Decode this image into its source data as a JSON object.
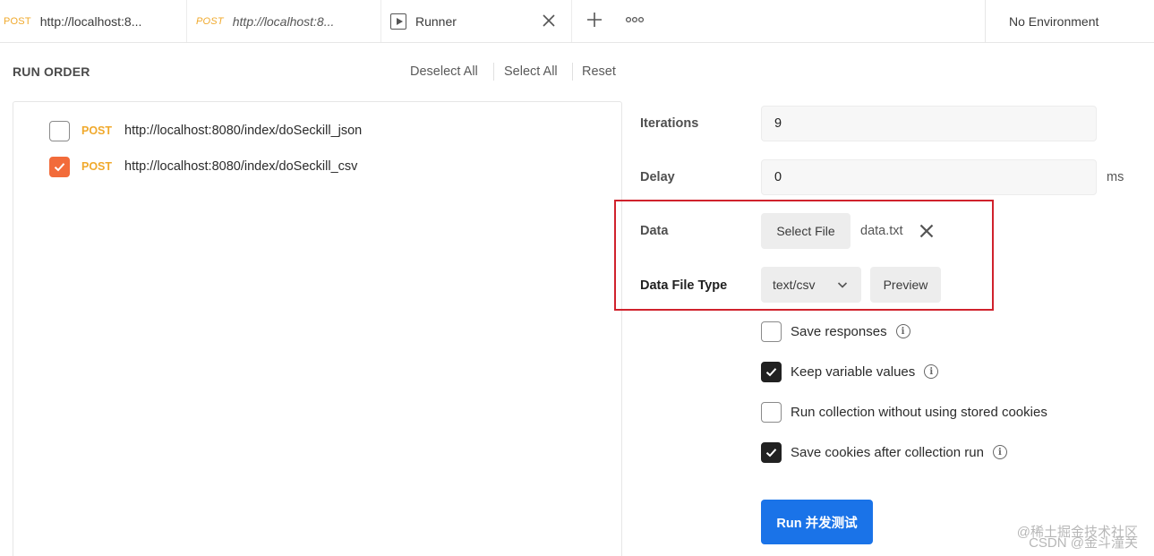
{
  "tabs": [
    {
      "method": "POST",
      "url": "http://localhost:8..."
    },
    {
      "method": "POST",
      "url": "http://localhost:8..."
    },
    {
      "label": "Runner"
    }
  ],
  "environment": "No Environment",
  "run_order": {
    "title": "RUN ORDER",
    "deselect_all": "Deselect All",
    "select_all": "Select All",
    "reset": "Reset",
    "requests": [
      {
        "method": "POST",
        "url": "http://localhost:8080/index/doSeckill_json",
        "checked": false
      },
      {
        "method": "POST",
        "url": "http://localhost:8080/index/doSeckill_csv",
        "checked": true
      }
    ]
  },
  "settings": {
    "iterations_label": "Iterations",
    "iterations_value": "9",
    "delay_label": "Delay",
    "delay_value": "0",
    "delay_unit": "ms",
    "data_label": "Data",
    "select_file_label": "Select File",
    "file_name": "data.txt",
    "data_file_type_label": "Data File Type",
    "data_file_type_value": "text/csv",
    "preview_label": "Preview",
    "options": [
      {
        "label": "Save responses",
        "checked": false
      },
      {
        "label": "Keep variable values",
        "checked": true
      },
      {
        "label": "Run collection without using stored cookies",
        "checked": false
      },
      {
        "label": "Save cookies after collection run",
        "checked": true
      }
    ],
    "run_button": "Run 并发测试"
  },
  "watermark": {
    "line1": "@稀土掘金技术社区",
    "line2": "CSDN @金斗潼关"
  },
  "colors": {
    "accent_blue": "#1a73e8",
    "checkbox_orange": "#f26b3a",
    "post_method": "#f0a92c",
    "highlight_red": "#d0222c"
  }
}
